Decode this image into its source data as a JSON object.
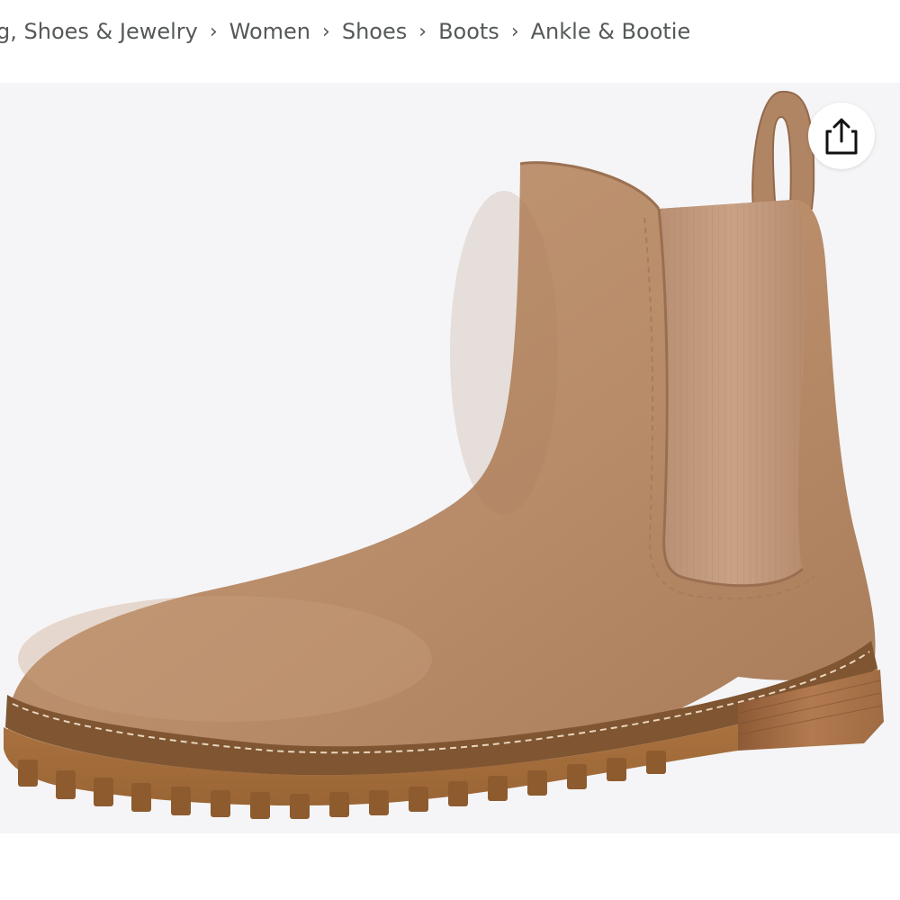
{
  "breadcrumb": {
    "items": [
      {
        "label": "g, Shoes & Jewelry"
      },
      {
        "label": "Women"
      },
      {
        "label": "Shoes"
      },
      {
        "label": "Boots"
      },
      {
        "label": "Ankle & Bootie"
      }
    ],
    "separator": "›"
  },
  "product": {
    "image_icon": "chelsea-boot-photo",
    "colors": {
      "suede": "#b98d6b",
      "elastic": "#c49a7c",
      "sole": "#a8703f",
      "background": "#f5f5f7"
    }
  },
  "share": {
    "icon": "share-icon"
  }
}
